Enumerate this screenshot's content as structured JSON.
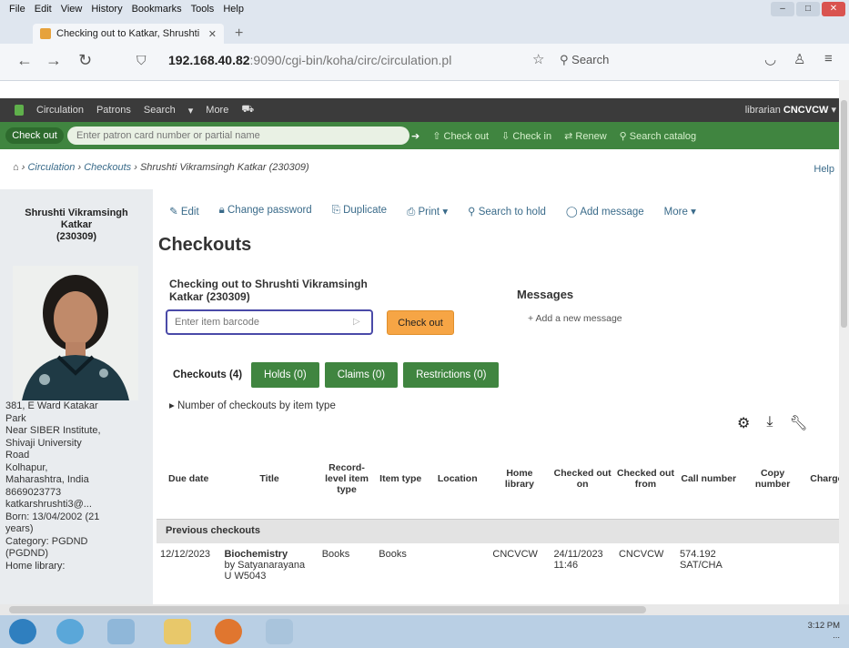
{
  "browser": {
    "menu": [
      "File",
      "Edit",
      "View",
      "History",
      "Bookmarks",
      "Tools",
      "Help"
    ],
    "tab_title": "Checking out to Katkar, Shrushti",
    "url_host": "192.168.40.82",
    "url_rest": ":9090/cgi-bin/koha/circ/circulation.pl",
    "search_placeholder": "Search"
  },
  "koha_nav": {
    "items": [
      "Circulation",
      "Patrons",
      "Search",
      "More"
    ],
    "user_prefix": "librarian",
    "user_branch": "CNCVCW"
  },
  "search_bar": {
    "tab_label": "Check out",
    "patron_placeholder": "Enter patron card number or partial name",
    "actions": [
      "Check out",
      "Check in",
      "Renew",
      "Search catalog"
    ]
  },
  "breadcrumbs": {
    "items": [
      "Circulation",
      "Checkouts",
      "Shrushti Vikramsingh Katkar (230309)"
    ],
    "help": "Help"
  },
  "patron": {
    "name": "Shrushti Vikramsingh Katkar",
    "cardnumber": "(230309)",
    "info": [
      "381, E Ward Katakar",
      "Park",
      "Near SIBER Institute,",
      "Shivaji University",
      "Road",
      "Kolhapur,",
      "Maharashtra, India",
      "8669023773",
      "katkarshrushti3@...",
      "Born: 13/04/2002 (21",
      "years)",
      "Category: PGDND",
      "(PGDND)",
      "Home library:"
    ]
  },
  "toolbar": {
    "items": [
      "Edit",
      "Change password",
      "Duplicate",
      "Print",
      "Search to hold",
      "Add message",
      "More"
    ]
  },
  "main": {
    "heading": "Checkouts",
    "checking_out": "Checking out to Shrushti Vikramsingh Katkar (230309)",
    "barcode_placeholder": "Enter item barcode",
    "checkout_button": "Check out",
    "messages_title": "Messages",
    "add_message": "Add a new message",
    "tabs": [
      "Checkouts (4)",
      "Holds (0)",
      "Claims (0)",
      "Restrictions (0)"
    ],
    "num_checkouts": "Number of checkouts by item type"
  },
  "table": {
    "headers": [
      "Due date",
      "Title",
      "Record-level item type",
      "Item type",
      "Location",
      "Home library",
      "Checked out on",
      "Checked out from",
      "Call number",
      "Copy number",
      "Charge"
    ],
    "group_label": "Previous checkouts",
    "rows": [
      {
        "due_date": "12/12/2023",
        "title": "Biochemistry",
        "author": "by Satyanarayana U W5043",
        "record_type": "Books",
        "item_type": "Books",
        "location": "",
        "home_library": "CNCVCW",
        "checked_out_on": "24/11/2023 11:46",
        "checked_out_from": "CNCVCW",
        "call_number": "574.192 SAT/CHA",
        "copy_number": "",
        "charge": ""
      }
    ]
  },
  "taskbar": {
    "time": "3:12 PM",
    "date": "..."
  }
}
